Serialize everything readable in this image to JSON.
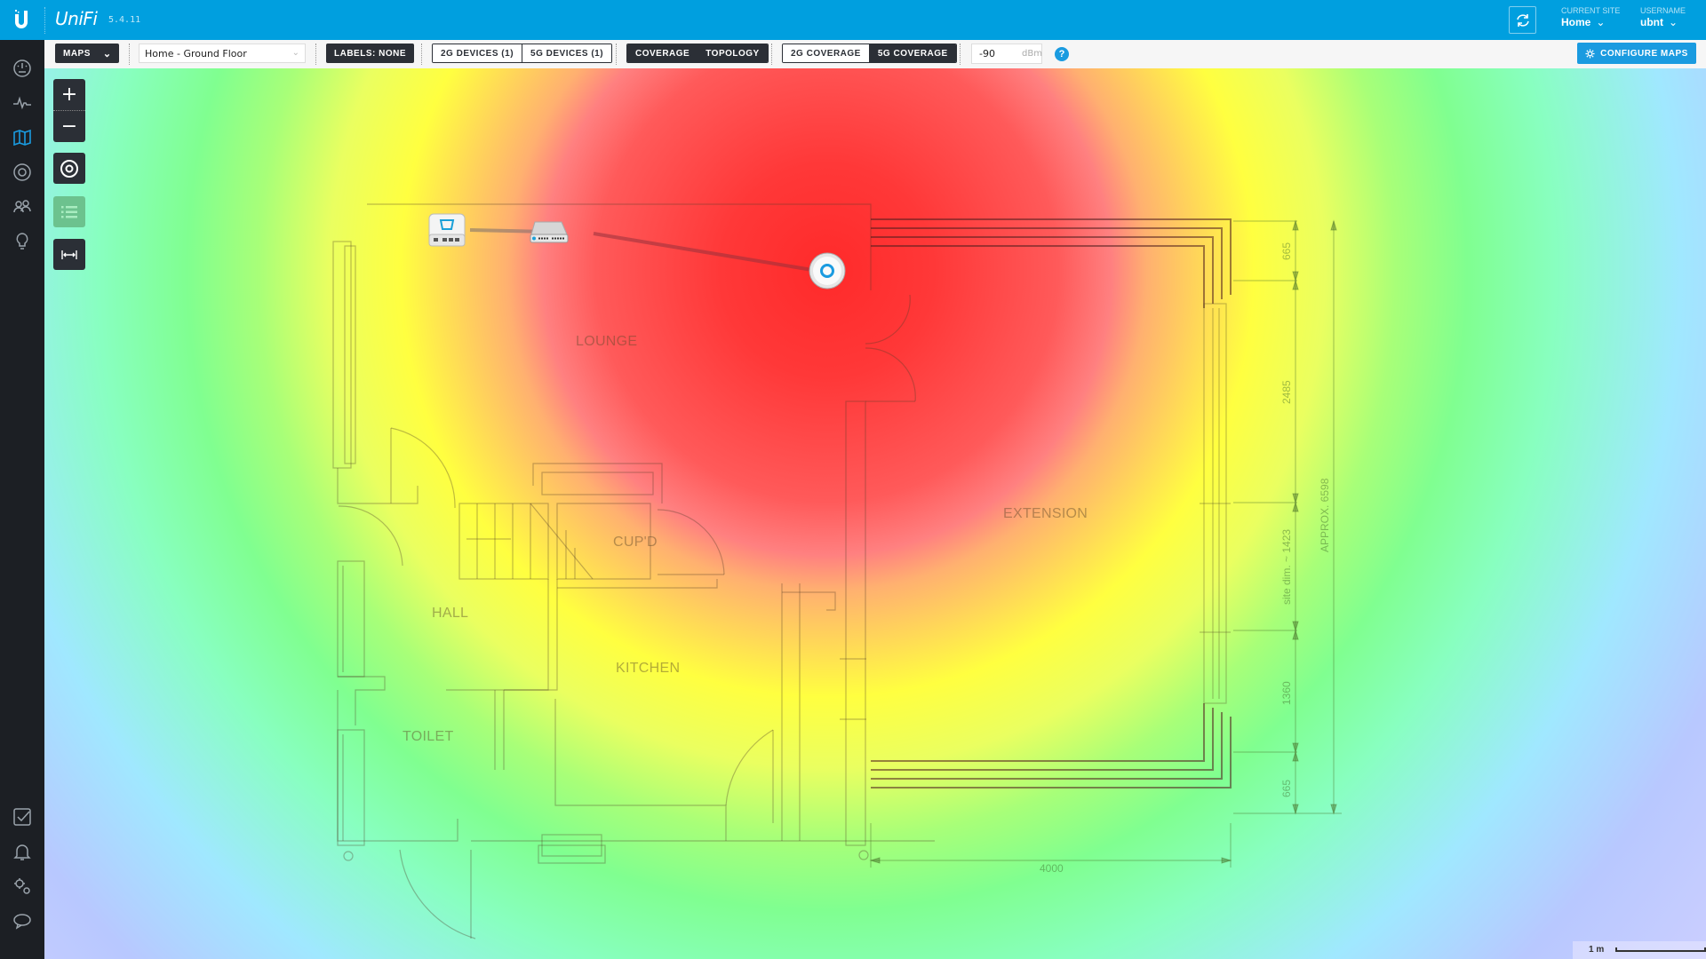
{
  "app": {
    "brand": "UniFi",
    "version": "5.4.11"
  },
  "header": {
    "current_site_label": "CURRENT SITE",
    "current_site_value": "Home",
    "username_label": "USERNAME",
    "username_value": "ubnt",
    "refresh_icon": "refresh-icon"
  },
  "sidebar": {
    "top_items": [
      {
        "name": "dashboard",
        "icon": "dashboard-gauge-icon"
      },
      {
        "name": "statistics",
        "icon": "pulse-icon"
      },
      {
        "name": "map",
        "icon": "map-icon",
        "active": true
      },
      {
        "name": "devices",
        "icon": "device-target-icon"
      },
      {
        "name": "clients",
        "icon": "users-icon"
      },
      {
        "name": "insights",
        "icon": "lightbulb-icon"
      }
    ],
    "bottom_items": [
      {
        "name": "events",
        "icon": "checkbox-icon"
      },
      {
        "name": "alerts",
        "icon": "bell-icon"
      },
      {
        "name": "settings",
        "icon": "gears-icon"
      },
      {
        "name": "support",
        "icon": "chat-bubble-icon"
      }
    ]
  },
  "toolbar": {
    "maps_label": "MAPS",
    "map_select_value": "Home - Ground Floor",
    "labels_button": "LABELS: NONE",
    "devices_2g": "2G DEVICES (1)",
    "devices_5g": "5G DEVICES (1)",
    "coverage": "COVERAGE",
    "topology": "TOPOLOGY",
    "coverage_2g": "2G COVERAGE",
    "coverage_5g": "5G COVERAGE",
    "active_coverage_band": "5G",
    "dbm_value": "-90",
    "dbm_unit": "dBm",
    "help": "?",
    "configure_maps": "CONFIGURE MAPS"
  },
  "map": {
    "rooms": [
      "LOUNGE",
      "EXTENSION",
      "CUP'D",
      "HALL",
      "KITCHEN",
      "TOILET"
    ],
    "dimensions": {
      "d665_top": "665",
      "d2485": "2485",
      "site_dim": "site dim. ~ 1423",
      "d1360": "1360",
      "d665_bottom": "665",
      "approx": "APPROX. 6598",
      "width_4000": "4000"
    },
    "devices": [
      {
        "type": "gateway",
        "icon": "gateway-icon"
      },
      {
        "type": "switch",
        "icon": "switch-icon"
      },
      {
        "type": "access-point",
        "icon": "access-point-icon"
      }
    ],
    "heatmap_colors": {
      "strong": "#ff2a2a",
      "medium": "#ffff40",
      "weak": "#80ff90",
      "weakest": "#b8c8ff"
    },
    "scale_label": "1 m"
  }
}
